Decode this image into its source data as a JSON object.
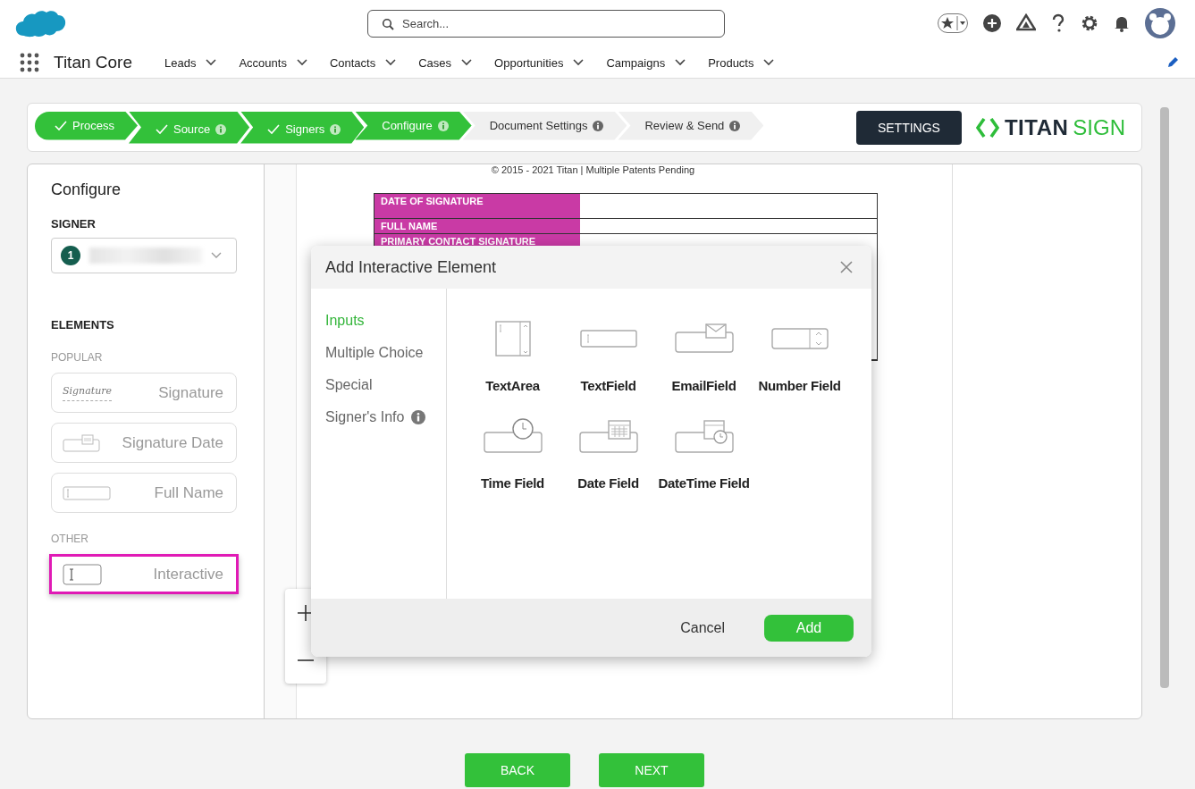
{
  "header": {
    "search": {
      "placeholder": "Search..."
    },
    "app_name": "Titan Core",
    "nav_items": [
      "Leads",
      "Accounts",
      "Contacts",
      "Cases",
      "Opportunities",
      "Campaigns",
      "Products"
    ]
  },
  "stepper": {
    "steps": [
      {
        "label": "Process",
        "reached": true,
        "completed": true,
        "info": false
      },
      {
        "label": "Source",
        "reached": true,
        "completed": true,
        "info": true
      },
      {
        "label": "Signers",
        "reached": true,
        "completed": true,
        "info": true
      },
      {
        "label": "Configure",
        "reached": true,
        "completed": false,
        "info": true
      },
      {
        "label": "Document Settings",
        "reached": false,
        "completed": false,
        "info": true
      },
      {
        "label": "Review & Send",
        "reached": false,
        "completed": false,
        "info": true
      }
    ],
    "settings_button": "SETTINGS",
    "brand": {
      "word1": "TITAN",
      "word2": "SIGN"
    }
  },
  "sidebar": {
    "title": "Configure",
    "signer_label": "SIGNER",
    "signer": {
      "number": "1"
    },
    "elements_label": "ELEMENTS",
    "groups": [
      {
        "label": "POPULAR",
        "items": [
          {
            "label": "Signature",
            "kind": "signature",
            "sample": "Signature",
            "selected": false
          },
          {
            "label": "Signature Date",
            "kind": "date",
            "selected": false
          },
          {
            "label": "Full Name",
            "kind": "text",
            "selected": false
          }
        ]
      },
      {
        "label": "OTHER",
        "items": [
          {
            "label": "Interactive",
            "kind": "interactive",
            "selected": true
          }
        ]
      }
    ]
  },
  "document": {
    "footer_text": "© 2015 - 2021 Titan | Multiple Patents Pending",
    "table_rows": [
      "DATE OF SIGNATURE",
      "FULL NAME",
      "PRIMARY CONTACT SIGNATURE"
    ]
  },
  "dialog": {
    "title": "Add Interactive Element",
    "categories": [
      {
        "label": "Inputs",
        "selected": true,
        "info": false
      },
      {
        "label": "Multiple Choice",
        "selected": false,
        "info": false
      },
      {
        "label": "Special",
        "selected": false,
        "info": false
      },
      {
        "label": "Signer's Info",
        "selected": false,
        "info": true
      }
    ],
    "elements": [
      {
        "label": "TextArea",
        "kind": "textarea"
      },
      {
        "label": "TextField",
        "kind": "textfield"
      },
      {
        "label": "EmailField",
        "kind": "email"
      },
      {
        "label": "Number Field",
        "kind": "number"
      },
      {
        "label": "Time Field",
        "kind": "time"
      },
      {
        "label": "Date Field",
        "kind": "date"
      },
      {
        "label": "DateTime Field",
        "kind": "datetime"
      }
    ],
    "cancel_button": "Cancel",
    "add_button": "Add"
  },
  "footer": {
    "back_button": "BACK",
    "next_button": "NEXT"
  }
}
